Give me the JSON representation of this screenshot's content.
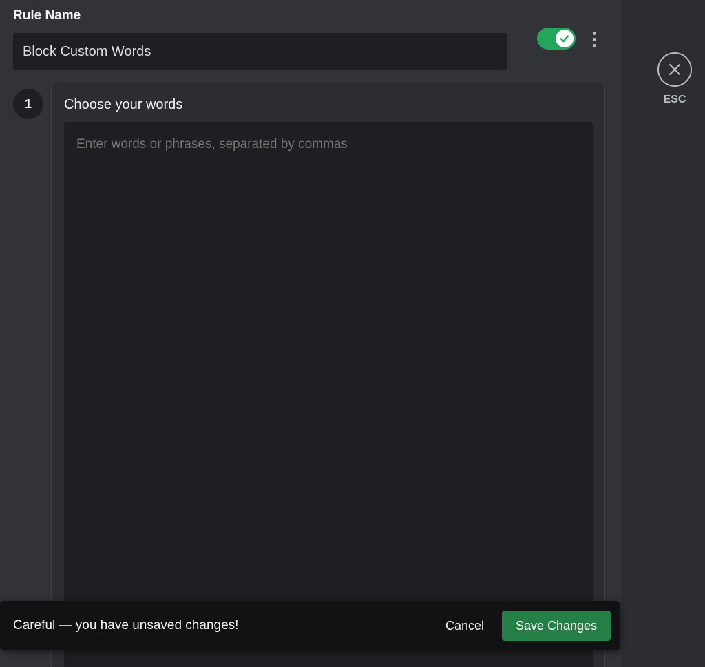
{
  "rule": {
    "name_label": "Rule Name",
    "name_value": "Block Custom Words",
    "enabled": true
  },
  "step": {
    "number": "1",
    "title": "Choose your words",
    "words_placeholder": "Enter words or phrases, separated by commas"
  },
  "esc": {
    "label": "ESC"
  },
  "unsaved_bar": {
    "message": "Careful — you have unsaved changes!",
    "cancel_label": "Cancel",
    "save_label": "Save Changes"
  },
  "colors": {
    "toggle_on": "#23a55a",
    "save_button": "#248046",
    "background": "#313338",
    "input_bg": "#1e1f22"
  },
  "icons": {
    "toggle": "check-icon",
    "more": "more-vertical-icon",
    "close": "close-icon"
  }
}
